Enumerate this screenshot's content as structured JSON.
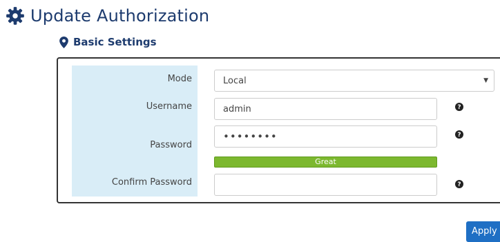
{
  "page": {
    "title": "Update Authorization"
  },
  "section": {
    "title": "Basic Settings"
  },
  "form": {
    "mode": {
      "label": "Mode",
      "value": "Local"
    },
    "username": {
      "label": "Username",
      "value": "admin"
    },
    "password": {
      "label": "Password",
      "masked_value": "••••••••"
    },
    "strength": {
      "label": "Great",
      "color": "#7cb82f"
    },
    "confirm_password": {
      "label": "Confirm Password",
      "value": ""
    }
  },
  "actions": {
    "apply_label": "Apply"
  },
  "colors": {
    "accent": "#1d3b6e",
    "label_bg": "#d9edf7",
    "button": "#1f6fc4"
  },
  "icons": {
    "title": "gear-icon",
    "section": "map-marker-icon",
    "help": "question-circle-icon"
  }
}
